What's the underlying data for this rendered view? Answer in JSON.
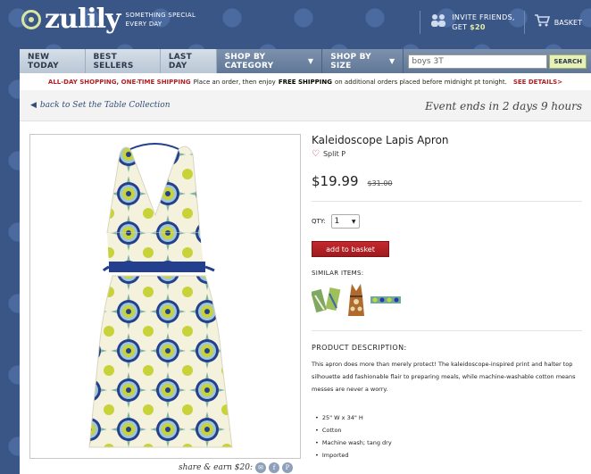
{
  "header": {
    "logo": "zulily",
    "tagline_line1": "SOMETHING SPECIAL",
    "tagline_line2": "EVERY DAY",
    "invite_line1": "INVITE FRIENDS,",
    "invite_get": "GET",
    "invite_amount": "$20",
    "basket_label": "BASKET",
    "invite_icon": "people-icon",
    "basket_icon": "cart-icon"
  },
  "nav": {
    "items": [
      "NEW TODAY",
      "BEST SELLERS",
      "LAST DAY"
    ],
    "dropdowns": [
      "SHOP BY CATEGORY",
      "SHOP BY SIZE"
    ],
    "search_value": "boys 3T",
    "search_button": "SEARCH"
  },
  "promo": {
    "red_text": "ALL-DAY SHOPPING, ONE-TIME SHIPPING",
    "mid_text": "Place an order, then enjoy",
    "bold_text": "FREE SHIPPING",
    "end_text": "on additional orders placed before midnight pt tonight.",
    "details_link": "SEE DETAILS>"
  },
  "topbar": {
    "back_link": "back to Set the Table Collection",
    "event_text": "Event ends in 2 days 9 hours"
  },
  "product": {
    "title": "Kaleidoscope Lapis Apron",
    "brand": "Split P",
    "price": "$19.99",
    "old_price": "$31.00",
    "qty_label": "QTY:",
    "qty_value": "1",
    "add_button": "add to basket",
    "similar_label": "SIMILAR ITEMS:",
    "desc_label": "PRODUCT DESCRIPTION:",
    "description": "This apron does more than merely protect! The kaleidoscope-inspired print and halter top silhouette add fashionable flair to preparing meals, while machine-washable cotton means messes are never a worry.",
    "bullets": [
      "25\" W x 34\" H",
      "Cotton",
      "Machine wash; tang dry",
      "Imported"
    ]
  },
  "share": {
    "label": "share & earn $20:"
  },
  "colors": {
    "background": "#3a5687",
    "accent_red": "#b22025",
    "apron_blue": "#233f8e",
    "apron_lime": "#c8d33a"
  }
}
